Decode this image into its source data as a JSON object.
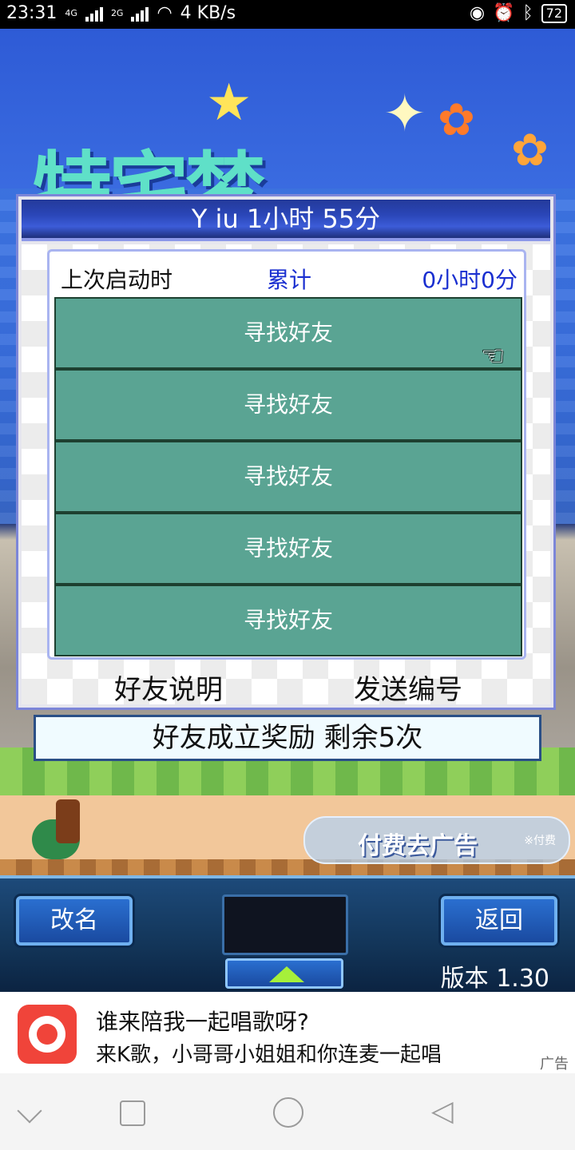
{
  "status": {
    "time": "23:31",
    "network1": "4G",
    "network2": "2G",
    "speed": "4 KB/s",
    "battery": "72"
  },
  "game": {
    "logo_text": "特宅梦",
    "ad_pill": {
      "label": "付费去广告",
      "tag": "※付费"
    }
  },
  "dialog": {
    "title": "Y iu  1小时 55分",
    "last_start_label": "上次启动时",
    "total_label": "累计",
    "total_value": "0小时0分",
    "friend_slots": [
      "寻找好友",
      "寻找好友",
      "寻找好友",
      "寻找好友",
      "寻找好友"
    ],
    "help_label": "好友说明",
    "send_label": "发送编号"
  },
  "reward_bar": "好友成立奖励  剩余5次",
  "controls": {
    "rename_label": "改名",
    "back_label": "返回",
    "version": "版本 1.30"
  },
  "ad_banner": {
    "title": "谁来陪我一起唱歌呀?",
    "subtitle": "来K歌，小哥哥小姐姐和你连麦一起唱",
    "tag": "广告"
  }
}
